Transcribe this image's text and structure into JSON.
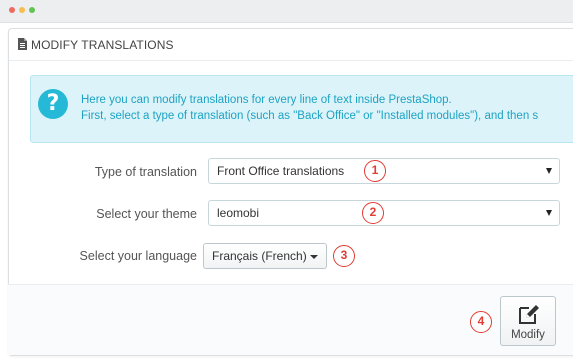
{
  "window": {
    "controls": [
      "close",
      "minimize",
      "maximize"
    ]
  },
  "panel": {
    "title": "MODIFY TRANSLATIONS",
    "title_icon": "document-icon"
  },
  "alert": {
    "icon": "question-icon",
    "icon_glyph": "?",
    "line1": "Here you can modify translations for every line of text inside PrestaShop.",
    "line2": "First, select a type of translation (such as \"Back Office\" or \"Installed modules\"), and then s"
  },
  "form": {
    "type": {
      "label": "Type of translation",
      "value": "Front Office translations",
      "step": "1"
    },
    "theme": {
      "label": "Select your theme",
      "value": "leomobi",
      "step": "2"
    },
    "language": {
      "label": "Select your language",
      "value": "Français (French)",
      "step": "3"
    }
  },
  "footer": {
    "modify_label": "Modify",
    "modify_icon": "edit-icon",
    "step": "4"
  },
  "colors": {
    "accent": "#25b9d7",
    "alert_bg": "#dcf4f9",
    "step_marker": "#e23b34"
  }
}
